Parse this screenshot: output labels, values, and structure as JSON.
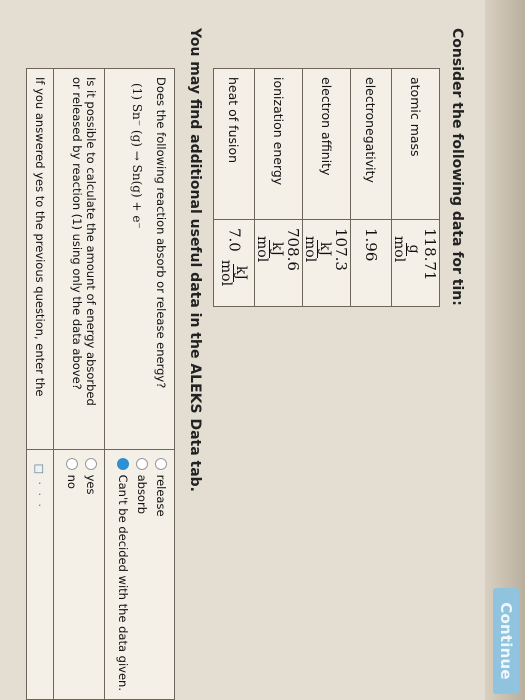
{
  "header": {
    "continue_label": "Continue"
  },
  "intro": "Consider the following data for tin:",
  "data_table": [
    {
      "property": "atomic mass",
      "value": "118.71",
      "unit_num": "g",
      "unit_den": "mol"
    },
    {
      "property": "electronegativity",
      "value": "1.96",
      "unit_num": "",
      "unit_den": ""
    },
    {
      "property": "electron affinity",
      "value": "107.3",
      "unit_num": "kJ",
      "unit_den": "mol"
    },
    {
      "property": "ionization energy",
      "value": "708.6",
      "unit_num": "kJ",
      "unit_den": "mol"
    },
    {
      "property": "heat of fusion",
      "value": "7.0",
      "unit_num": "kJ",
      "unit_den": "mol"
    }
  ],
  "hint": "You may find additional useful data in the ALEKS Data tab.",
  "questions": {
    "q1": {
      "text": "Does the following reaction absorb or release energy?",
      "reaction": "(1)   Sn⁻ (g) → Sn(g) + e⁻",
      "options": [
        "release",
        "absorb",
        "Can't be decided with the data given."
      ],
      "selected_index": 2
    },
    "q2": {
      "text_line1": "Is it possible to calculate the amount of energy absorbed",
      "text_line2": "or released by reaction (1) using only the data above?",
      "options": [
        "yes",
        "no"
      ]
    },
    "q3": {
      "text": "If you answered yes to the previous question, enter the",
      "icons": "□ · · ·"
    }
  },
  "colors": {
    "accent": "#2f8fd0",
    "button": "#8fc3de"
  }
}
